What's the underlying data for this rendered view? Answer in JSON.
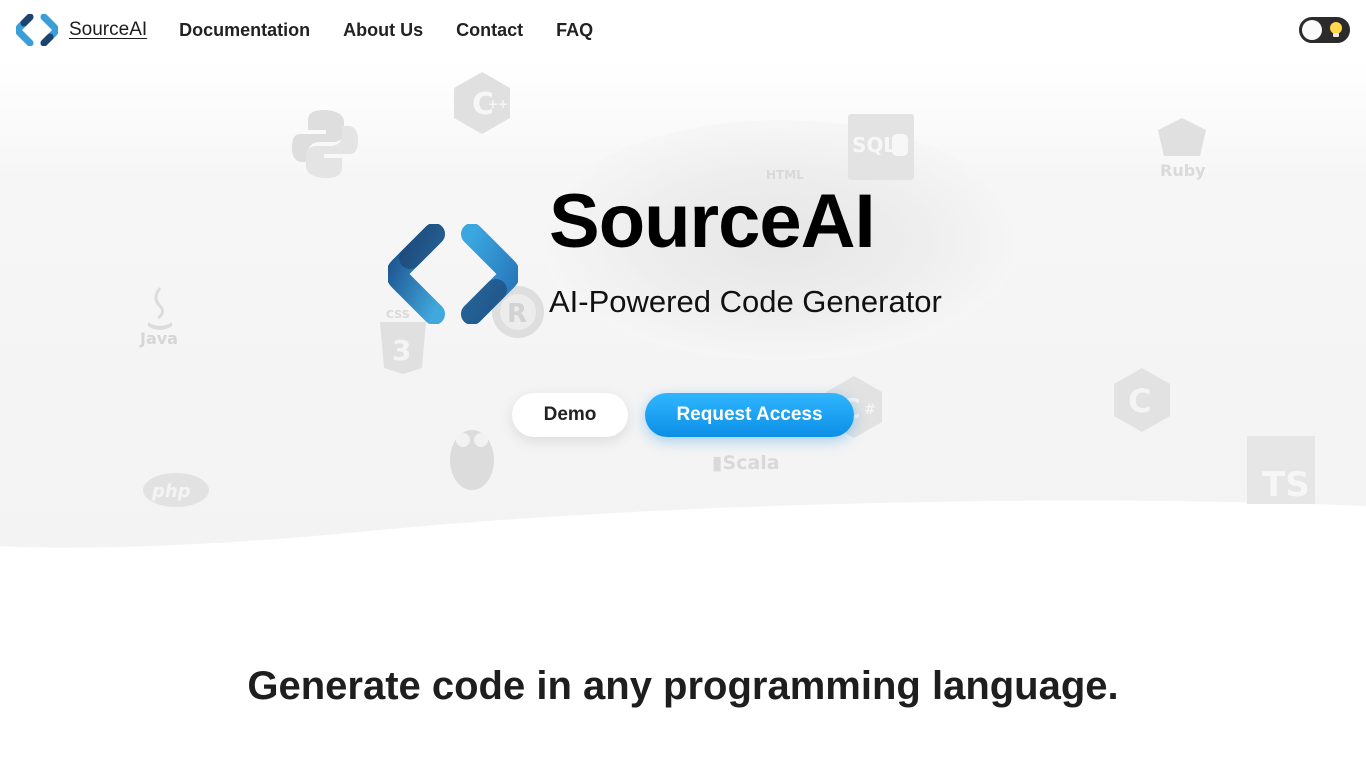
{
  "nav": {
    "brand": "SourceAI",
    "links": [
      "Documentation",
      "About Us",
      "Contact",
      "FAQ"
    ],
    "theme_toggle_icon": "lightbulb-icon"
  },
  "hero": {
    "title": "SourceAI",
    "subtitle": "AI-Powered Code Generator",
    "demo_label": "Demo",
    "access_label": "Request Access",
    "background_icons": {
      "python": "python-logo",
      "cpp": "C++",
      "sql": "SQL",
      "html": "HTML",
      "ruby": "Ruby",
      "java": "Java",
      "css": "CSS",
      "csharp": "C#",
      "c": "C",
      "go": "go-gopher",
      "scala": "Scala",
      "php": "php",
      "ts": "TS",
      "rust": "R"
    }
  },
  "section": {
    "title": "Generate code in any programming language."
  },
  "colors": {
    "accent": "#1aa3f5",
    "logo_light": "#3aa0d8",
    "logo_dark": "#1d3f6e",
    "hero_bg": "#f3f3f3"
  }
}
